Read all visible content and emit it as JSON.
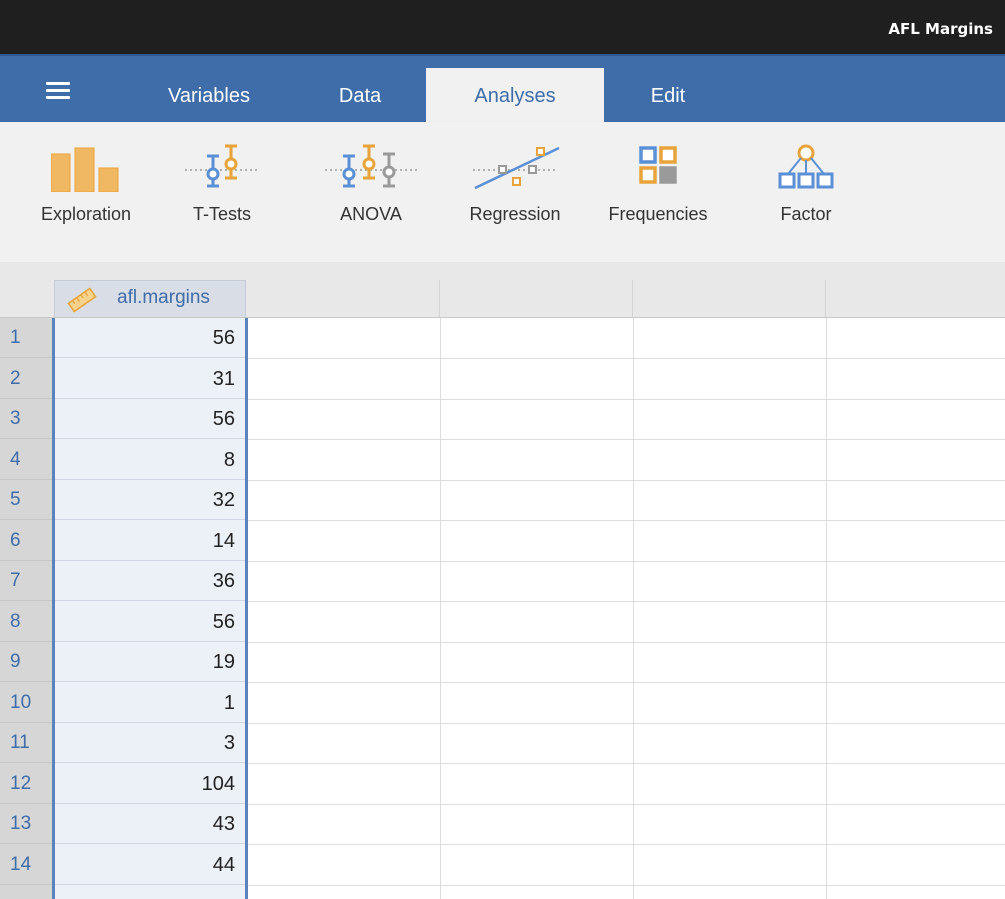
{
  "window": {
    "title": "AFL Margins"
  },
  "tabs": [
    {
      "label": "Variables"
    },
    {
      "label": "Data"
    },
    {
      "label": "Analyses"
    },
    {
      "label": "Edit"
    }
  ],
  "ribbon": [
    {
      "label": "Exploration",
      "icon": "exploration-icon"
    },
    {
      "label": "T-Tests",
      "icon": "t-tests-icon"
    },
    {
      "label": "ANOVA",
      "icon": "anova-icon"
    },
    {
      "label": "Regression",
      "icon": "regression-icon"
    },
    {
      "label": "Frequencies",
      "icon": "frequencies-icon"
    },
    {
      "label": "Factor",
      "icon": "factor-icon"
    }
  ],
  "spreadsheet": {
    "column": {
      "name": "afl.margins",
      "icon": "ruler-icon"
    },
    "rows": [
      {
        "num": "1",
        "value": "56"
      },
      {
        "num": "2",
        "value": "31"
      },
      {
        "num": "3",
        "value": "56"
      },
      {
        "num": "4",
        "value": "8"
      },
      {
        "num": "5",
        "value": "32"
      },
      {
        "num": "6",
        "value": "14"
      },
      {
        "num": "7",
        "value": "36"
      },
      {
        "num": "8",
        "value": "56"
      },
      {
        "num": "9",
        "value": "19"
      },
      {
        "num": "10",
        "value": "1"
      },
      {
        "num": "11",
        "value": "3"
      },
      {
        "num": "12",
        "value": "104"
      },
      {
        "num": "13",
        "value": "43"
      },
      {
        "num": "14",
        "value": "44"
      }
    ]
  },
  "colors": {
    "tabbar": "#3e6da9",
    "accent_orange": "#e8a33a",
    "accent_blue": "#5b8fd6",
    "accent_gray": "#9a9a9a"
  }
}
